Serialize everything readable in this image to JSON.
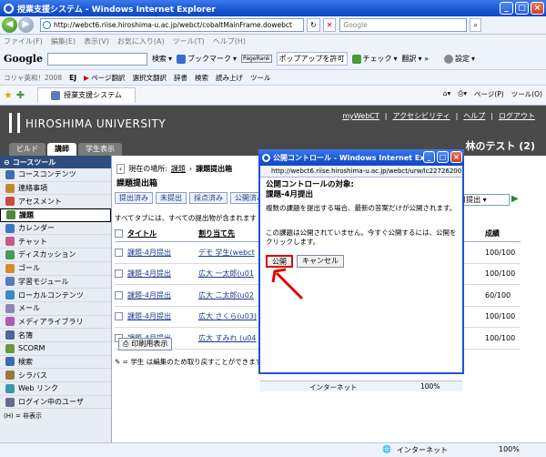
{
  "browser": {
    "title": "授業支援システム - Windows Internet Explorer",
    "url": "http://webct6.riise.hiroshima-u.ac.jp/webct/cobaltMainFrame.dowebct",
    "search_placeholder": "Google",
    "menu": [
      "ファイル(F)",
      "編集(E)",
      "表示(V)",
      "お気に入り(A)",
      "ツール(T)",
      "ヘルプ(H)"
    ],
    "google_toolbar": {
      "logo": "Google",
      "search_label": "検索",
      "bookmarks_label": "ブックマーク",
      "pagerank_label": "PageRank",
      "popup_label": "ポップアップを許可",
      "check_label": "チェック",
      "translate_label": "翻訳",
      "settings_label": "設定"
    },
    "links_bar": [
      "コリャ英和！2008",
      "EJ",
      "ページ翻訳",
      "選択文翻訳",
      "辞書",
      "検索",
      "読み上げ",
      "ツール"
    ],
    "tab_label": "授業支援システム",
    "tab_tools": [
      "ページ(P)",
      "ツール(O)"
    ],
    "status": {
      "zone": "インターネット",
      "zoom": "100%"
    }
  },
  "header": {
    "university": "HIROSHIMA UNIVERSITY",
    "links": [
      "myWebCT",
      "アクセシビリティ",
      "ヘルプ",
      "ログアウト"
    ],
    "role_tabs": [
      "ビルド",
      "講師",
      "学生表示"
    ],
    "active_role": "講師",
    "user": "林のテスト (2)"
  },
  "sidebar": {
    "heading": "コースツール",
    "items": [
      {
        "label": "コースコンテンツ",
        "color": "#3d6fb0"
      },
      {
        "label": "連絡事項",
        "color": "#c08a2a"
      },
      {
        "label": "アセスメント",
        "color": "#d04a3a"
      },
      {
        "label": "課題",
        "color": "#4a8a3a",
        "active": true
      },
      {
        "label": "カレンダー",
        "color": "#3a78c8"
      },
      {
        "label": "チャット",
        "color": "#c85a8a"
      },
      {
        "label": "ディスカッション",
        "color": "#4a9a5a"
      },
      {
        "label": "ゴール",
        "color": "#d88a2a"
      },
      {
        "label": "学習モジュール",
        "color": "#5a7ab8"
      },
      {
        "label": "ローカルコンテンツ",
        "color": "#3a8ac8"
      },
      {
        "label": "メール",
        "color": "#8a8ab0"
      },
      {
        "label": "メディアライブラリ",
        "color": "#b05ab0"
      },
      {
        "label": "名簿",
        "color": "#4a6a9a"
      },
      {
        "label": "SCORM",
        "color": "#6a9a3a"
      },
      {
        "label": "検索",
        "color": "#3a6ab0"
      },
      {
        "label": "シラバス",
        "color": "#9a7a3a"
      },
      {
        "label": "Web リンク",
        "color": "#3a9aaa"
      },
      {
        "label": "ログイン中のユーザ",
        "color": "#6a6a8a"
      }
    ],
    "legend": "(H) = 非表示"
  },
  "main": {
    "breadcrumb_prefix": "現在の場所:",
    "breadcrumb_link": "課題",
    "breadcrumb_current": "課題提出箱",
    "page_title": "課題提出箱",
    "filters": [
      "提出済み",
      "未提出",
      "採点済み",
      "公開済み"
    ],
    "filter_select": "4月提出",
    "note": "すべてタブには、すべての提出物が含まれます",
    "columns": [
      "タイトル",
      "割り当て先",
      "成績"
    ],
    "rows": [
      {
        "title": "課題-4月提出",
        "assignee": "デモ 学生(webct",
        "grade": "100/100"
      },
      {
        "title": "課題-4月提出",
        "assignee": "広大 一太郎(u01",
        "grade": "100/100"
      },
      {
        "title": "課題-4月提出",
        "assignee": "広大 二太郎(u02",
        "grade": "60/100"
      },
      {
        "title": "課題-4月提出",
        "assignee": "広大 さくら(u03)",
        "grade": "100/100"
      },
      {
        "title": "課題-4月提出",
        "assignee": "広大 すみれ (u04",
        "grade": "100/100"
      }
    ],
    "print_label": "印刷用表示",
    "footnote": "= 学生 は編集のため取り戻すことができます"
  },
  "popup": {
    "title": "公開コントロール - Windows Internet Ex...",
    "url": "http://webct6.riise.hiroshima-u.ac.jp/webct/urw/lc22726200",
    "target_label": "公開コントロールの対象:",
    "target_name": "課題-4月提出",
    "description": "複数の課題を提出する場合、最新の答案だけが公開されます。",
    "message": "この課題は公開されていません。今すぐ公開するには、公開をクリックします。",
    "publish_label": "公開",
    "cancel_label": "キャンセル",
    "status_zone": "インターネット",
    "status_zoom": "100%"
  },
  "colors": {
    "titlebar": "#1a55d4",
    "header": "#4a4a4a",
    "highlight": "#e00000"
  }
}
